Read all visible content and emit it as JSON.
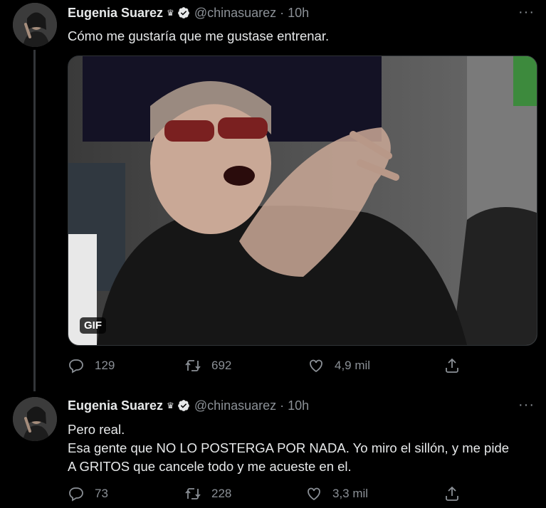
{
  "tweets": [
    {
      "author": {
        "name": "Eugenia Suarez",
        "handle": "@chinasuarez",
        "crown": "♛"
      },
      "time": "10h",
      "separator": "·",
      "more": "···",
      "text_lines": [
        "Cómo me gustaría que me gustase entrenar."
      ],
      "media": {
        "type": "gif",
        "badge": "GIF"
      },
      "stats": {
        "replies": "129",
        "retweets": "692",
        "likes": "4,9 mil"
      }
    },
    {
      "author": {
        "name": "Eugenia Suarez",
        "handle": "@chinasuarez",
        "crown": "♛"
      },
      "time": "10h",
      "separator": "·",
      "more": "···",
      "text_lines": [
        "Pero real.",
        "Esa gente que NO LO POSTERGA POR NADA. Yo miro el sillón, y me pide",
        "A GRITOS que cancele todo y me acueste en el."
      ],
      "stats": {
        "replies": "73",
        "retweets": "228",
        "likes": "3,3 mil"
      }
    }
  ],
  "colors": {
    "background": "#000000",
    "text": "#e7e9ea",
    "muted": "#8b9096",
    "verified": "#e7e9ea"
  },
  "icons": [
    "reply-icon",
    "retweet-icon",
    "like-icon",
    "share-icon",
    "verified-icon",
    "crown-icon",
    "more-icon"
  ]
}
